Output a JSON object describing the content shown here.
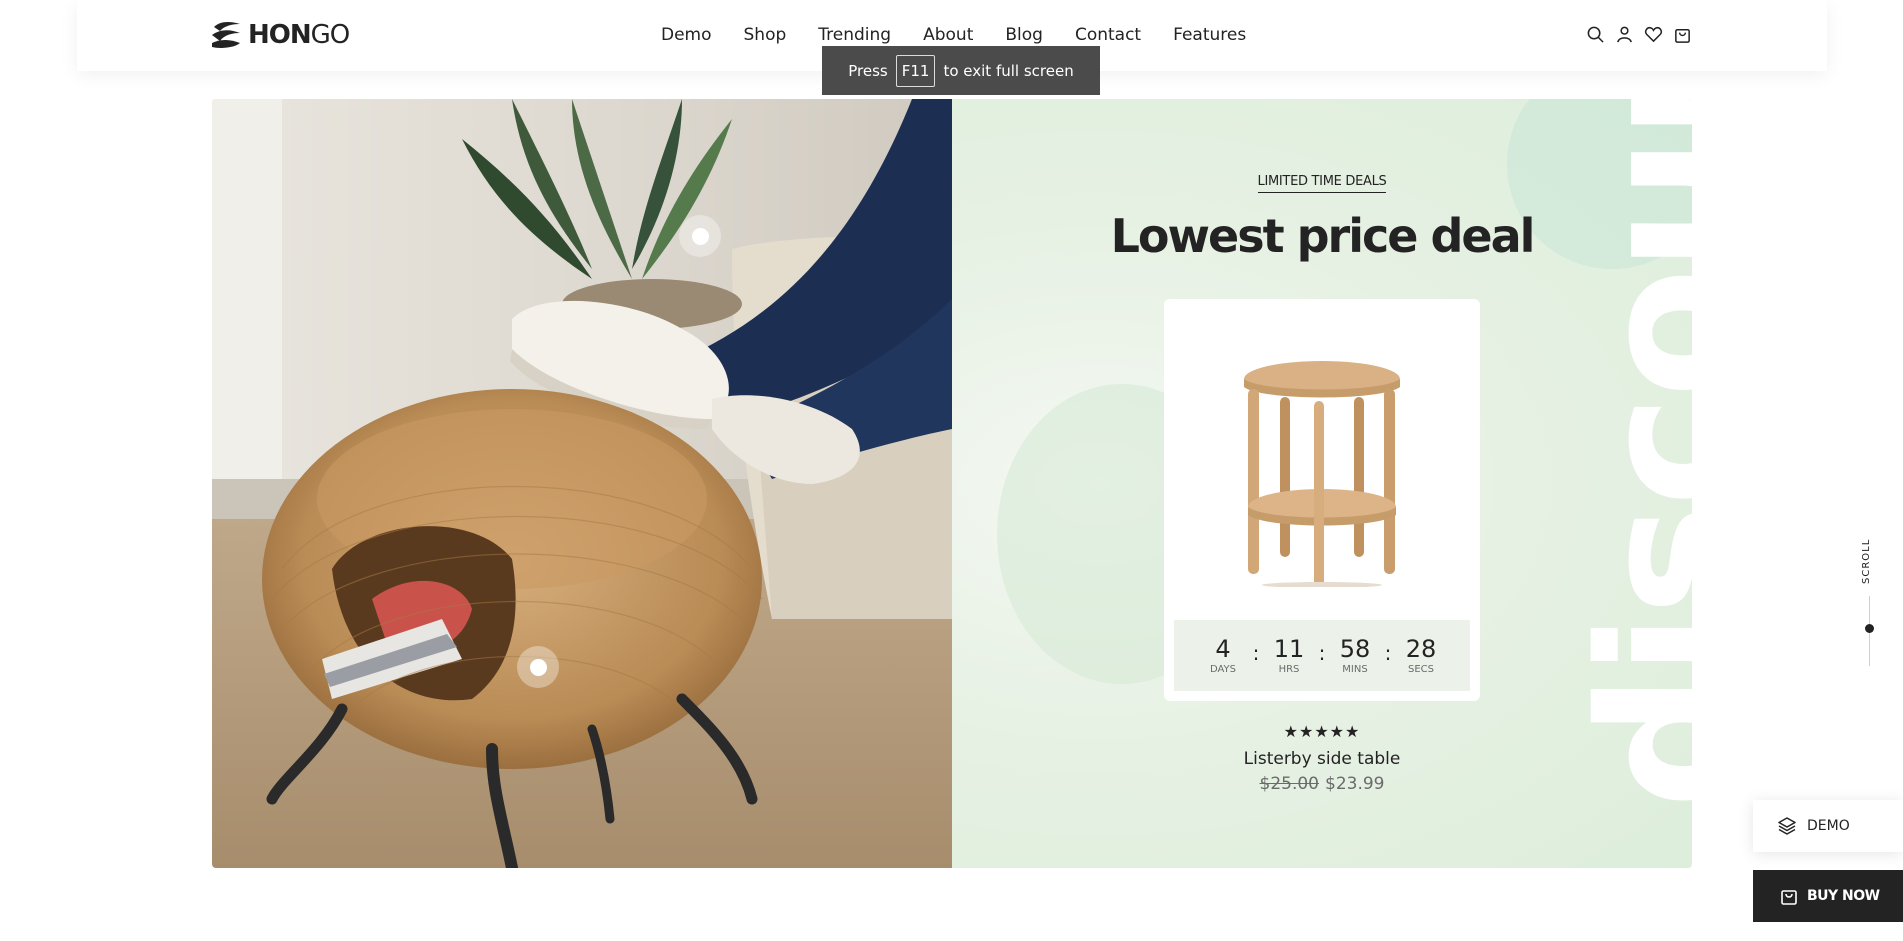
{
  "brand": {
    "logo_text_bold": "HON",
    "logo_text_thin": "GO"
  },
  "nav": [
    "Demo",
    "Shop",
    "Trending",
    "About",
    "Blog",
    "Contact",
    "Features"
  ],
  "header_icons": [
    "search-icon",
    "user-icon",
    "heart-icon",
    "bag-icon"
  ],
  "toast": {
    "before": "Press",
    "key": "F11",
    "after": "to exit full screen"
  },
  "deal": {
    "eyebrow": "LIMITED TIME DEALS",
    "headline": "Lowest price deal",
    "watermark": "discount",
    "countdown": [
      {
        "value": "4",
        "label": "Days"
      },
      {
        "value": "11",
        "label": "Hrs"
      },
      {
        "value": "58",
        "label": "Mins"
      },
      {
        "value": "28",
        "label": "Secs"
      }
    ],
    "separator": ":",
    "rating_stars": "★★★★★",
    "rating": 5,
    "product_name": "Listerby side table",
    "price_old": "$25.00",
    "price_new": "$23.99"
  },
  "scroll_label": "SCROLL",
  "demo_button": "DEMO",
  "buy_button": "BUY NOW",
  "colors": {
    "text": "#232323",
    "deal_bg": "#e7f1e4",
    "countdown_bg": "#ecf2e9"
  }
}
